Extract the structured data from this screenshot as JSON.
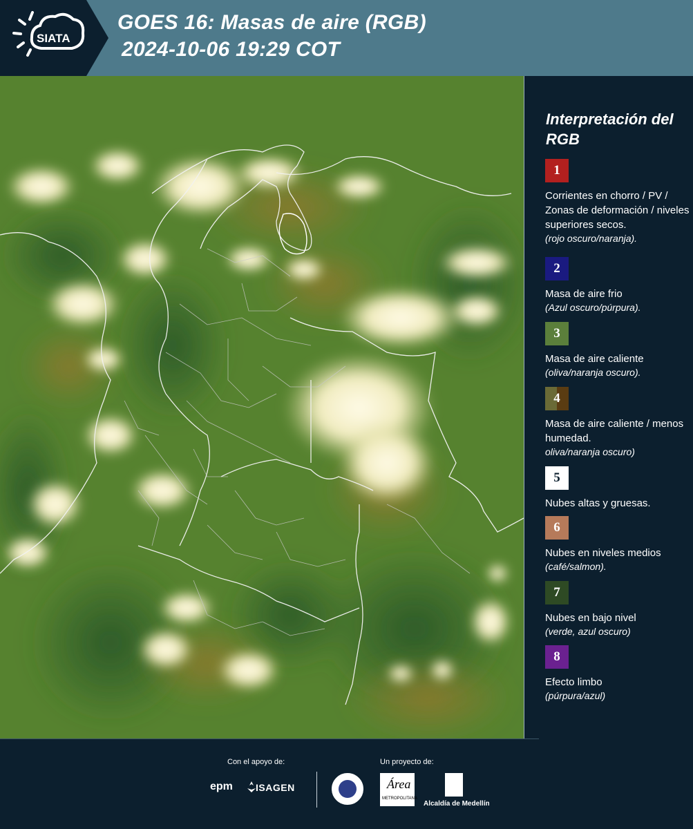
{
  "header": {
    "logo_text": "SIATA",
    "title_line1": "GOES 16: Masas de aire (RGB)",
    "title_line2": "2024-10-06 19:29 COT"
  },
  "legend": {
    "title": "Interpretación del RGB",
    "items": [
      {
        "num": "1",
        "color": "#b3201f",
        "text": "Corrientes en chorro / PV / Zonas de deformación / niveles superiores secos.",
        "sub": "(rojo oscuro/naranja)."
      },
      {
        "num": "2",
        "color": "#1a1a80",
        "text": "Masa de aire frio",
        "sub": "(Azul oscuro/púrpura)."
      },
      {
        "num": "3",
        "color": "#5b7f3b",
        "text": "Masa de aire caliente",
        "sub": "(oliva/naranja oscuro)."
      },
      {
        "num": "4",
        "color": "#6a5a24",
        "text": "Masa de aire caliente / menos humedad.",
        "sub": "oliva/naranja oscuro)"
      },
      {
        "num": "5",
        "color": "#ffffff",
        "text": "Nubes altas y gruesas.",
        "sub": ""
      },
      {
        "num": "6",
        "color": "#b67a5a",
        "text": "Nubes en niveles medios",
        "sub": "(café/salmon)."
      },
      {
        "num": "7",
        "color": "#2e4a24",
        "text": "Nubes en bajo nivel",
        "sub": "(verde, azul oscuro)"
      },
      {
        "num": "8",
        "color": "#6b2190",
        "text": "Efecto limbo",
        "sub": "(púrpura/azul)"
      }
    ]
  },
  "footer": {
    "support_label": "Con el apoyo de:",
    "project_label": "Un proyecto de:",
    "epm": "epm",
    "isagen": "ISAGEN",
    "metro_script": "Área",
    "metro_name": "METROPOLITANA",
    "alcaldia": "Alcaldía de Medellín"
  }
}
